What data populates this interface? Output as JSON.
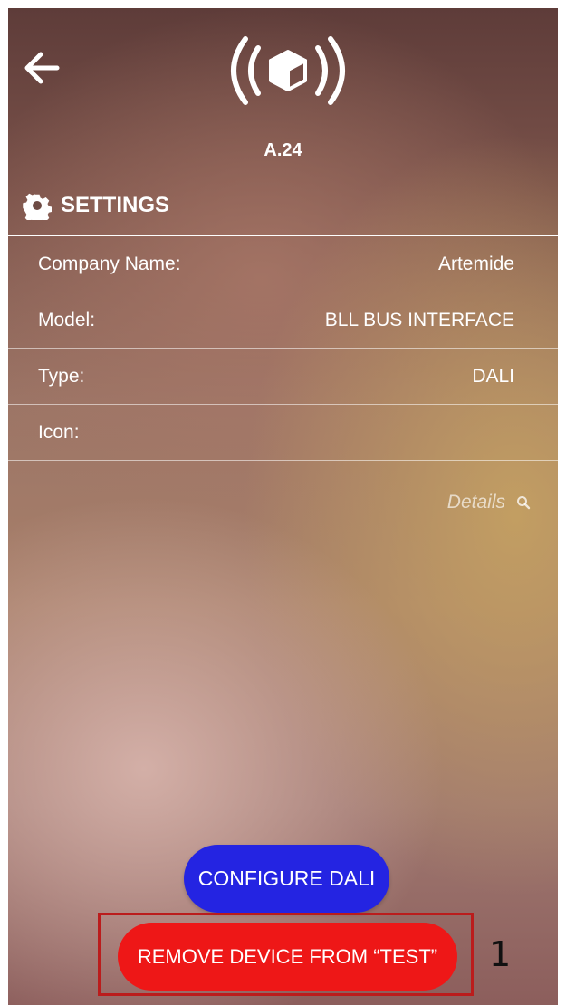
{
  "device_id": "A.24",
  "settings": {
    "title": "SETTINGS",
    "rows": [
      {
        "label": "Company Name:",
        "value": "Artemide"
      },
      {
        "label": "Model:",
        "value": "BLL BUS INTERFACE"
      },
      {
        "label": "Type:",
        "value": "DALI"
      },
      {
        "label": "Icon:",
        "value": ""
      }
    ],
    "details_link": "Details"
  },
  "buttons": {
    "configure": "CONFIGURE DALI",
    "remove": "REMOVE DEVICE FROM “TEST”"
  },
  "annotation": {
    "number": "1"
  },
  "icons": {
    "back": "back-arrow-icon",
    "logo": "device-signal-logo-icon",
    "settings": "gear-icon",
    "details": "search-icon"
  },
  "colors": {
    "configure_button": "#2424e2",
    "remove_button": "#ee1717",
    "highlight": "#bb1c1c"
  }
}
